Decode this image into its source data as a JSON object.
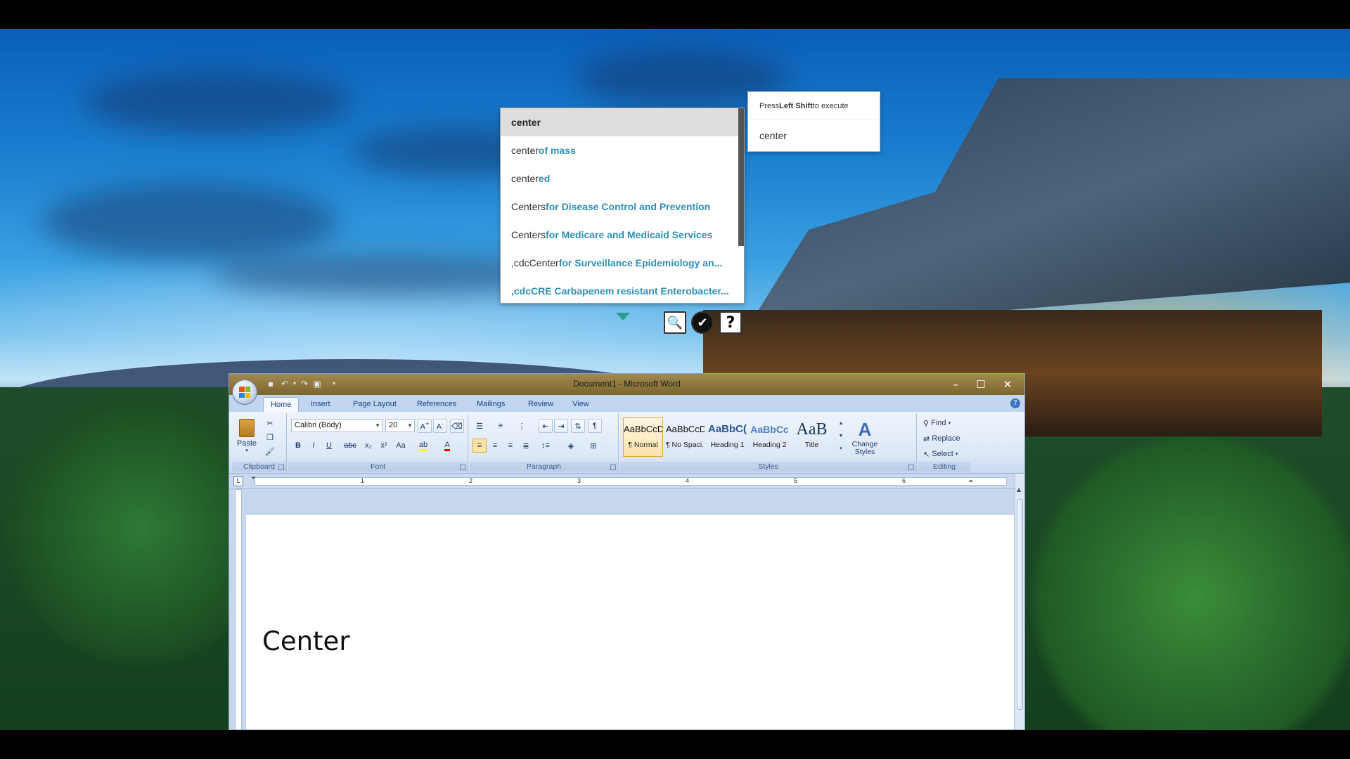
{
  "colors": {
    "accent_suggestion": "#2f8fb8",
    "titlebar": "#8c743a",
    "ribbon_text": "#15428b"
  },
  "suggestions": [
    {
      "base": "center",
      "ext": "",
      "active": true
    },
    {
      "base": "center",
      "ext": " of mass",
      "active": false
    },
    {
      "base": "center",
      "ext": "ed",
      "active": false
    },
    {
      "base": "Centers",
      "ext": " for Disease Control and Prevention",
      "active": false
    },
    {
      "base": "Centers",
      "ext": " for Medicare and Medicaid Services",
      "active": false
    },
    {
      "base": ",cdcCenter",
      "ext": " for Surveillance Epidemiology an...",
      "active": false
    },
    {
      "base": "",
      "ext": ",cdcCRE Carbapenem resistant Enterobacter...",
      "active": false
    }
  ],
  "tools": {
    "search_icon": "🔍",
    "check_icon": "✔",
    "help_icon": "?"
  },
  "exec_tooltip": {
    "prefix": "Press ",
    "key": "Left Shift",
    "suffix": " to execute",
    "word": "center"
  },
  "word": {
    "title": "Document1 - Microsoft Word",
    "tabs": [
      "Home",
      "Insert",
      "Page Layout",
      "References",
      "Mailings",
      "Review",
      "View"
    ],
    "clipboard": {
      "paste": "Paste",
      "label": "Clipboard"
    },
    "font": {
      "name": "Calibri (Body)",
      "size": "20",
      "label": "Font"
    },
    "paragraph": {
      "label": "Paragraph"
    },
    "styles": {
      "label": "Styles",
      "items": [
        {
          "sample": "AaBbCcDc",
          "name": "¶ Normal"
        },
        {
          "sample": "AaBbCcDc",
          "name": "¶ No Spaci..."
        },
        {
          "sample": "AaBbC(",
          "name": "Heading 1"
        },
        {
          "sample": "AaBbCc",
          "name": "Heading 2"
        },
        {
          "sample": "AaB",
          "name": "Title"
        }
      ],
      "change_styles": "Change Styles"
    },
    "editing": {
      "find": "Find",
      "replace": "Replace",
      "select": "Select",
      "label": "Editing"
    },
    "ruler": [
      "1",
      "2",
      "3",
      "4",
      "5",
      "6"
    ],
    "document_text": "Center"
  }
}
